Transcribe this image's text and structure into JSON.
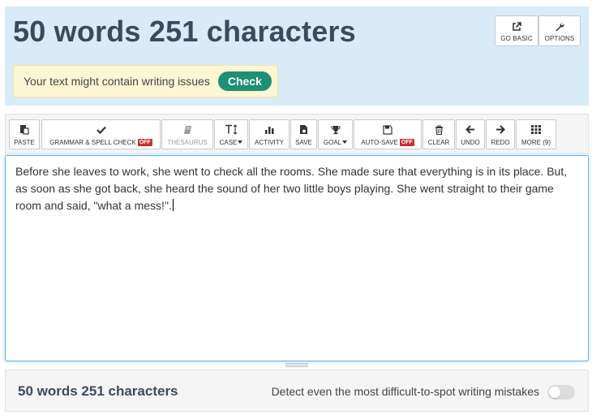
{
  "header": {
    "title": "50 words 251 characters",
    "go_basic_label": "GO BASIC",
    "options_label": "OPTIONS"
  },
  "issue_banner": {
    "text": "Your text might contain writing issues",
    "check_label": "Check"
  },
  "toolbar": {
    "paste": "PASTE",
    "grammar": "GRAMMAR & SPELL CHECK",
    "grammar_state": "OFF",
    "thesaurus": "THESAURUS",
    "case": "CASE",
    "activity": "ACTIVITY",
    "save": "SAVE",
    "goal": "GOAL",
    "autosave": "AUTO-SAVE",
    "autosave_state": "OFF",
    "clear": "CLEAR",
    "undo": "UNDO",
    "redo": "REDO",
    "more": "MORE (9)"
  },
  "editor": {
    "text": "Before she leaves to work, she went to check all the rooms. She made sure that everything is in its place. But, as soon as she got back, she heard the sound of her two little boys playing. She went straight to their game room and said, \"what a mess!\"."
  },
  "footer": {
    "count": "50 words 251 characters",
    "detect_text": "Detect even the most difficult-to-spot writing mistakes",
    "detect_enabled": false
  },
  "colors": {
    "header_bg": "#d9ebf6",
    "title": "#3c4a5c",
    "check_button": "#1f8f76",
    "off_badge": "#c9302c",
    "banner_bg": "#fdf6d3"
  }
}
